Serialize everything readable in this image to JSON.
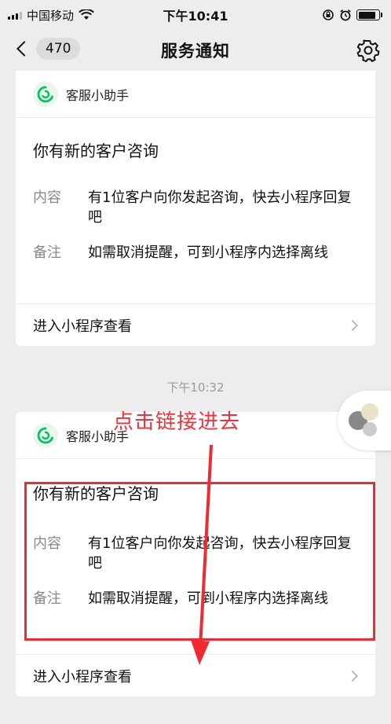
{
  "status_bar": {
    "carrier": "中国移动",
    "time": "下午10:41"
  },
  "nav": {
    "badge_count": "470",
    "title": "服务通知",
    "back_icon": "chevron-left-icon",
    "settings_icon": "gear-icon"
  },
  "messages": [
    {
      "sender": "客服小助手",
      "title": "你有新的客户咨询",
      "content_label": "内容",
      "content_value": "有1位客户向你发起咨询，快去小程序回复吧",
      "note_label": "备注",
      "note_value": "如需取消提醒，可到小程序内选择离线",
      "link_label": "进入小程序查看"
    },
    {
      "timestamp": "下午10:32",
      "sender": "客服小助手",
      "title": "你有新的客户咨询",
      "content_label": "内容",
      "content_value": "有1位客户向你发起咨询，快去小程序回复吧",
      "note_label": "备注",
      "note_value": "如需取消提醒，可到小程序内选择离线",
      "link_label": "进入小程序查看"
    }
  ],
  "annotation": {
    "text": "点击链接进去",
    "color": "#ee2b33"
  },
  "colors": {
    "background": "#ededed",
    "card": "#ffffff",
    "bot_icon_green": "#07c160"
  }
}
